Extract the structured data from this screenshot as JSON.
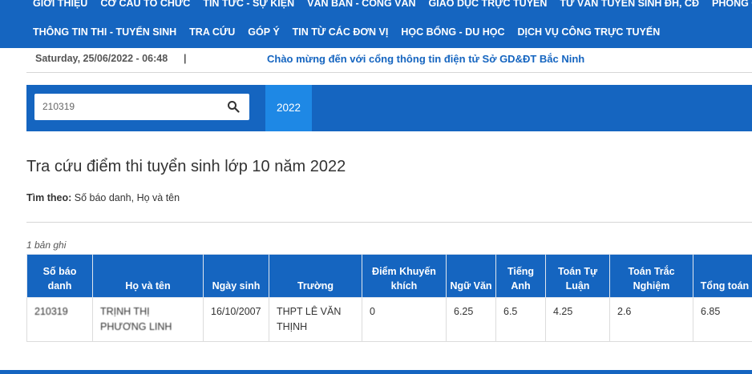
{
  "nav": {
    "row1": [
      "GIỚI THIỆU",
      "CƠ CẤU TỔ CHỨC",
      "TIN TỨC - SỰ KIỆN",
      "VĂN BẢN - CÔNG VĂN",
      "GIÁO DỤC TRỰC TUYẾN",
      "TƯ VẤN TUYỂN SINH ĐH, CĐ",
      "PHÒNG CHỐNG"
    ],
    "row2": [
      "THÔNG TIN THI - TUYỂN SINH",
      "TRA CỨU",
      "GÓP Ý",
      "TIN TỪ CÁC ĐƠN VỊ",
      "HỌC BỔNG - DU HỌC",
      "DỊCH VỤ CÔNG TRỰC TUYẾN"
    ]
  },
  "infobar": {
    "date": "Saturday, 25/06/2022 - 06:48",
    "separator": "|",
    "welcome": "Chào mừng đến với cổng thông tin điện tử Sở GD&ĐT Bắc Ninh"
  },
  "search": {
    "value": "210319",
    "year_tab": "2022"
  },
  "page": {
    "title": "Tra cứu điểm thi tuyển sinh lớp 10 năm 2022",
    "findby_label": "Tìm theo:",
    "findby_value": "Số báo danh, Họ và tên",
    "count": "1 bản ghi"
  },
  "table": {
    "headers": [
      "Số báo danh",
      "Họ và tên",
      "Ngày sinh",
      "Trường",
      "Điểm Khuyến khích",
      "Ngữ Văn",
      "Tiếng Anh",
      "Toán Tự Luận",
      "Toán Trắc Nghiệm",
      "Tổng toán"
    ],
    "rows": [
      [
        "210319",
        "TRỊNH THỊ PHƯƠNG LINH",
        "16/10/2007",
        "THPT LÊ VĂN THỊNH",
        "0",
        "6.25",
        "6.5",
        "4.25",
        "2.6",
        "6.85"
      ]
    ]
  },
  "colors": {
    "primary": "#1565c0",
    "active_tab": "#1e88e5"
  }
}
